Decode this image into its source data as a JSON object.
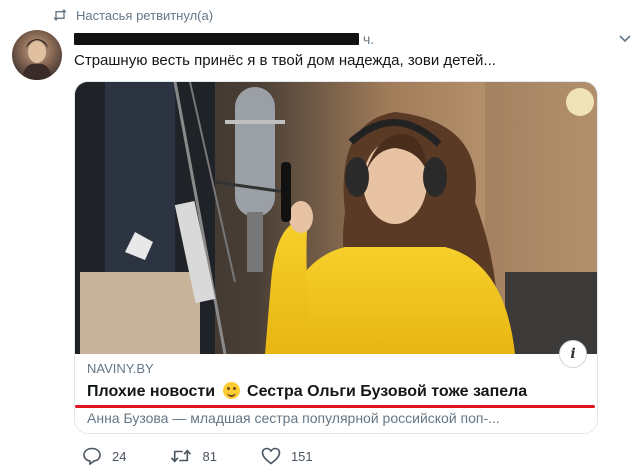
{
  "retweet": {
    "icon": "retweet-icon",
    "text": "Настасья ретвитнул(а)"
  },
  "tweet": {
    "time": "ч.",
    "text": "Страшную весть принёс я в твой дом надежда, зови детей..."
  },
  "card": {
    "domain": "NAVINY.BY",
    "title_before": "Плохие новости",
    "title_after": "Сестра Ольги Бузовой тоже запела",
    "description": "Анна Бузова — младшая сестра популярной российской поп-...",
    "info_label": "i"
  },
  "actions": {
    "replies": "24",
    "retweets": "81",
    "likes": "151"
  },
  "colors": {
    "accent_underline": "#e0141e",
    "muted_text": "#657786",
    "sweater": "#f0c21f"
  }
}
